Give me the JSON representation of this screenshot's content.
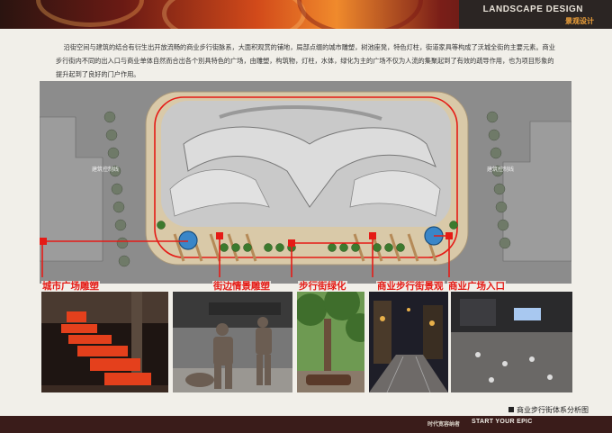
{
  "header": {
    "brand_en": "LANDSCAPE DESIGN",
    "brand_cn": "景观设计"
  },
  "intro_text": "沿街空间与建筑的结合有衍生出开放流畅的商业步行街脉系，大面积观赏的铺地，局部点缀的城市雕塑，树池座凳，特色灯柱，街道家具等构成了沃城全街的主要元素。商业步行街内不同的出入口与商业单体自然而合出各个別具特色的广场，由雕塑，构筑物，灯柱，水体，绿化为主的广场不仅为人流的集聚起到了有效的疏导作用，也为项目形象的提升起到了良好的门户作用。",
  "plan": {
    "left_label": "建筑控制线",
    "right_label": "建筑控制线"
  },
  "callouts": [
    {
      "label": "城市广场雕塑"
    },
    {
      "label": "街边情景雕塑"
    },
    {
      "label": "步行街绿化"
    },
    {
      "label": "商业步行街景观"
    },
    {
      "label": "商业广场入口"
    }
  ],
  "caption": "商业步行街体系分析图",
  "footer": {
    "tagline_cn": "时代宽容纳者",
    "tagline_en": "START YOUR EPIC"
  },
  "colors": {
    "accent_red": "#e51b16",
    "header_dark": "#2b2523",
    "footer_dark": "#3a1c1a"
  }
}
